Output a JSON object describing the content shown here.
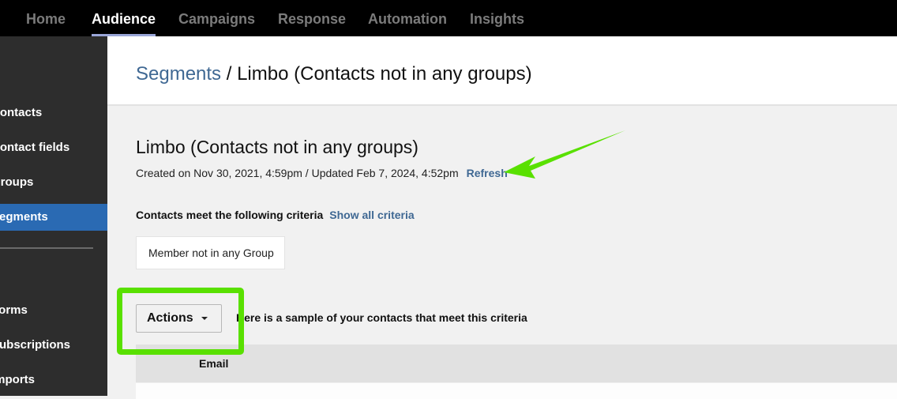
{
  "topnav": {
    "tabs": [
      {
        "label": "Home",
        "active": false
      },
      {
        "label": "Audience",
        "active": true
      },
      {
        "label": "Campaigns",
        "active": false
      },
      {
        "label": "Response",
        "active": false
      },
      {
        "label": "Automation",
        "active": false
      },
      {
        "label": "Insights",
        "active": false
      }
    ]
  },
  "sidebar": {
    "items": [
      {
        "label": "Contacts",
        "active": false
      },
      {
        "label": "Contact fields",
        "active": false
      },
      {
        "label": "Groups",
        "active": false
      },
      {
        "label": "Segments",
        "active": true
      },
      {
        "label": "Forms",
        "active": false
      },
      {
        "label": "Subscriptions",
        "active": false
      },
      {
        "label": "Imports",
        "active": false
      }
    ]
  },
  "header": {
    "breadcrumb_link": "Segments",
    "breadcrumb_separator": " / ",
    "breadcrumb_current": "Limbo (Contacts not in any groups)"
  },
  "segment": {
    "title": "Limbo (Contacts not in any groups)",
    "meta": "Created on Nov 30, 2021, 4:59pm / Updated Feb 7, 2024, 4:52pm",
    "refresh_label": "Refresh",
    "criteria_label": "Contacts meet the following criteria",
    "show_all_label": "Show all criteria",
    "criteria_chip": "Member not in any Group"
  },
  "actions": {
    "button_label": "Actions",
    "sample_text": "Here is a sample of your contacts that meet this criteria"
  },
  "table": {
    "columns": [
      "Email"
    ]
  },
  "annotations": {
    "highlight_color": "#59e000",
    "arrow_color": "#59e000"
  },
  "colors": {
    "link": "#3f6893",
    "sidebar_active": "#2a6ab3"
  }
}
